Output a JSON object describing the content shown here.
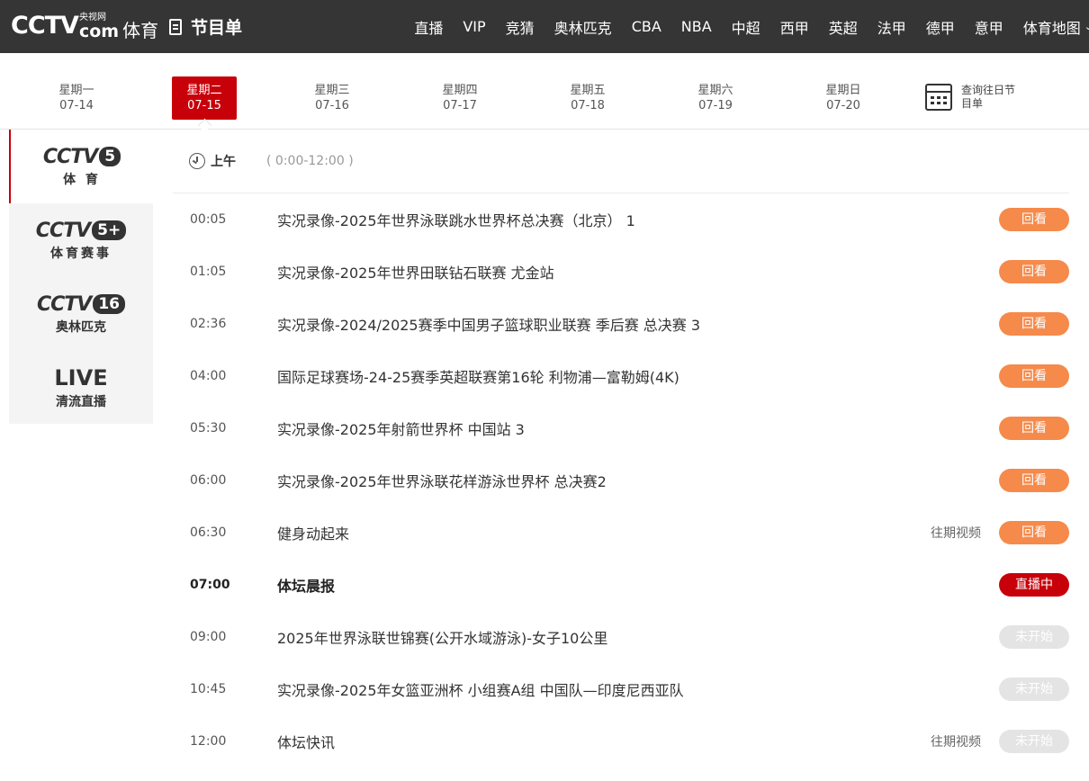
{
  "header": {
    "logo_main": "CCTV",
    "logo_cn": "央视网",
    "logo_com": "com",
    "logo_sport": "体育",
    "page_title": "节目单",
    "nav": [
      "直播",
      "VIP",
      "竞猜",
      "奥林匹克",
      "CBA",
      "NBA",
      "中超",
      "西甲",
      "英超",
      "法甲",
      "德甲",
      "意甲",
      "体育地图"
    ]
  },
  "days": [
    {
      "weekday": "星期一",
      "date": "07-14"
    },
    {
      "weekday": "星期二",
      "date": "07-15"
    },
    {
      "weekday": "星期三",
      "date": "07-16"
    },
    {
      "weekday": "星期四",
      "date": "07-17"
    },
    {
      "weekday": "星期五",
      "date": "07-18"
    },
    {
      "weekday": "星期六",
      "date": "07-19"
    },
    {
      "weekday": "星期日",
      "date": "07-20"
    }
  ],
  "history_label": "查询往日节目单",
  "channels": [
    {
      "logo": "CCTV",
      "num": "5",
      "name": "体 育"
    },
    {
      "logo": "CCTV",
      "num": "5+",
      "name": "体育赛事"
    },
    {
      "logo": "CCTV",
      "num": "16",
      "name": "奥林匹克"
    },
    {
      "logo": "LIVE",
      "num": "",
      "name": "清流直播"
    }
  ],
  "period": {
    "label": "上午",
    "range": "( 0:00-12:00 )"
  },
  "schedule": [
    {
      "time": "00:05",
      "title": "实况录像-2025年世界泳联跳水世界杯总决赛（北京） 1",
      "past": "",
      "button": "回看",
      "state": "replay"
    },
    {
      "time": "01:05",
      "title": "实况录像-2025年世界田联钻石联赛 尤金站",
      "past": "",
      "button": "回看",
      "state": "replay"
    },
    {
      "time": "02:36",
      "title": "实况录像-2024/2025赛季中国男子篮球职业联赛 季后赛 总决赛 3",
      "past": "",
      "button": "回看",
      "state": "replay"
    },
    {
      "time": "04:00",
      "title": "国际足球赛场-24-25赛季英超联赛第16轮 利物浦—富勒姆(4K)",
      "past": "",
      "button": "回看",
      "state": "replay"
    },
    {
      "time": "05:30",
      "title": "实况录像-2025年射箭世界杯 中国站 3",
      "past": "",
      "button": "回看",
      "state": "replay"
    },
    {
      "time": "06:00",
      "title": "实况录像-2025年世界泳联花样游泳世界杯 总决赛2",
      "past": "",
      "button": "回看",
      "state": "replay"
    },
    {
      "time": "06:30",
      "title": "健身动起来",
      "past": "往期视频",
      "button": "回看",
      "state": "replay"
    },
    {
      "time": "07:00",
      "title": "体坛晨报",
      "past": "",
      "button": "直播中",
      "state": "onair"
    },
    {
      "time": "09:00",
      "title": "2025年世界泳联世锦赛(公开水域游泳)-女子10公里",
      "past": "",
      "button": "未开始",
      "state": "upcoming"
    },
    {
      "time": "10:45",
      "title": "实况录像-2025年女篮亚洲杯 小组赛A组 中国队—印度尼西亚队",
      "past": "",
      "button": "未开始",
      "state": "upcoming"
    },
    {
      "time": "12:00",
      "title": "体坛快讯",
      "past": "往期视频",
      "button": "未开始",
      "state": "upcoming"
    }
  ],
  "colors": {
    "accent": "#c8000a",
    "replay": "#f58a4b",
    "upcoming": "#e4e4e4",
    "header_bg": "#353535"
  }
}
